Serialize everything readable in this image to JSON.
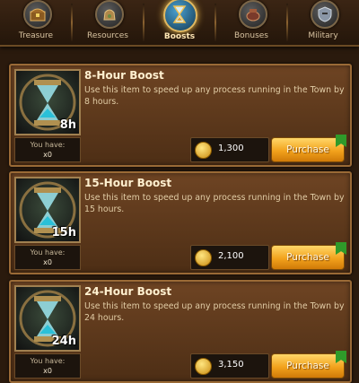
{
  "tabs": [
    {
      "label": "Treasure",
      "icon": "treasure-chest-icon",
      "active": false
    },
    {
      "label": "Resources",
      "icon": "resource-bag-icon",
      "active": false
    },
    {
      "label": "Boosts",
      "icon": "hourglass-icon",
      "active": true
    },
    {
      "label": "Bonuses",
      "icon": "bonus-pot-icon",
      "active": false
    },
    {
      "label": "Military",
      "icon": "shield-helmet-icon",
      "active": false
    }
  ],
  "items": [
    {
      "title": "8-Hour Boost",
      "description": "Use this item to speed up any process running in the Town by 8 hours.",
      "badge": "8h",
      "have_label": "You have:",
      "have_count": "x0",
      "price": "1,300",
      "buy_label": "Purchase"
    },
    {
      "title": "15-Hour Boost",
      "description": "Use this item to speed up any process running in the Town by 15 hours.",
      "badge": "15h",
      "have_label": "You have:",
      "have_count": "x0",
      "price": "2,100",
      "buy_label": "Purchase"
    },
    {
      "title": "24-Hour Boost",
      "description": "Use this item to speed up any process running in the Town by 24 hours.",
      "badge": "24h",
      "have_label": "You have:",
      "have_count": "x0",
      "price": "3,150",
      "buy_label": "Purchase"
    }
  ],
  "colors": {
    "accent": "#f2a21c",
    "card": "#5d3a1c",
    "frame": "#9a6a36"
  }
}
